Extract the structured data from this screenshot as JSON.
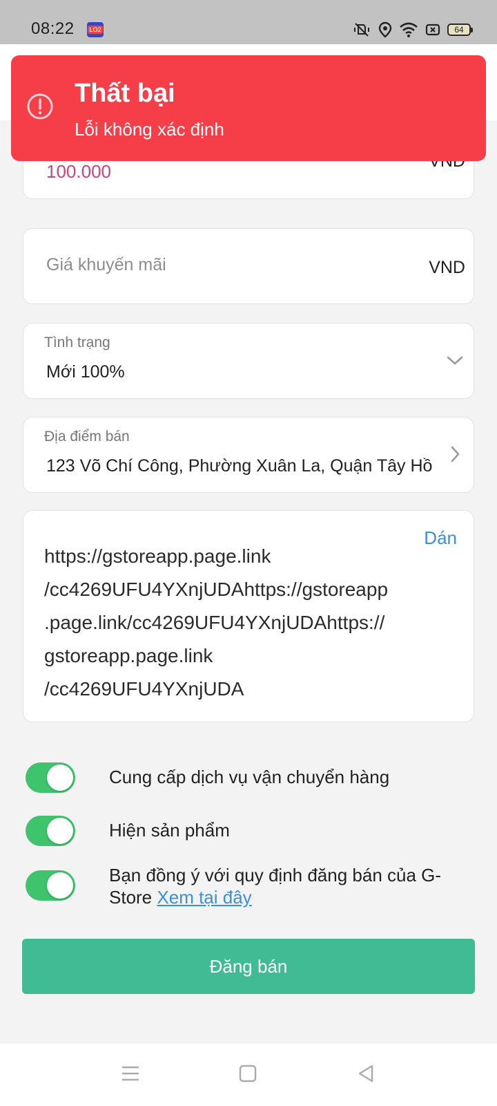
{
  "status_bar": {
    "time": "08:22",
    "app_badge": "LO2",
    "battery": "64"
  },
  "form": {
    "price": {
      "value": "100.000",
      "currency": "VND"
    },
    "promo_price": {
      "placeholder": "Giá khuyến mãi",
      "currency": "VND"
    },
    "condition": {
      "label": "Tình trạng",
      "value": "Mới 100%"
    },
    "location": {
      "label": "Địa điểm bán",
      "value": "123 Võ Chí Công, Phường Xuân La, Quận Tây Hồ"
    },
    "link": {
      "paste_label": "Dán",
      "text": "https://gstoreapp.page.link\n/cc4269UFU4YXnjUDAhttps://gstoreapp\n.page.link/cc4269UFU4YXnjUDAhttps://\ngstoreapp.page.link\n/cc4269UFU4YXnjUDA"
    }
  },
  "toggles": [
    {
      "label": "Cung cấp dịch vụ vận chuyển hàng",
      "on": true
    },
    {
      "label": "Hiện sản phẩm",
      "on": true
    },
    {
      "label": "Bạn đồng ý với quy định đăng bán của G-Store",
      "link_label": "Xem tại đây",
      "on": true
    }
  ],
  "submit_label": "Đăng bán",
  "toast": {
    "title": "Thất bại",
    "message": "Lỗi không xác định"
  },
  "colors": {
    "toast_bg": "#f63e49",
    "primary_button": "#40bb94",
    "toggle_on": "#3ec46d",
    "link": "#3a90d6",
    "price": "#c9447a"
  }
}
